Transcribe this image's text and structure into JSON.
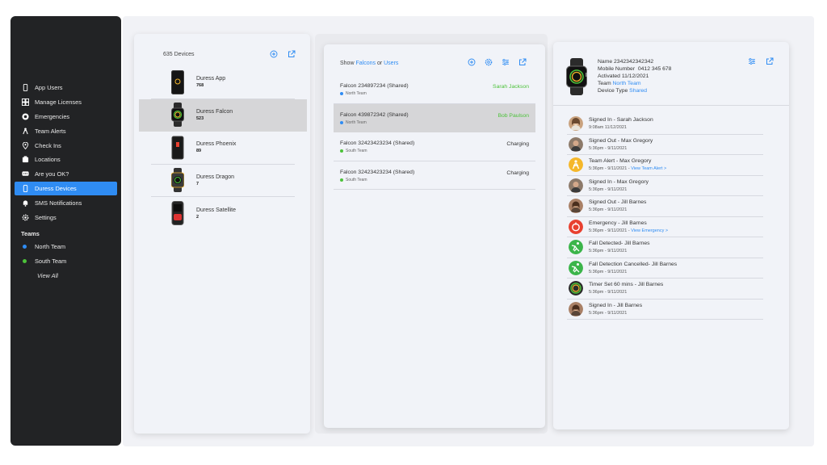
{
  "sidebar": {
    "items": [
      {
        "label": "App Users",
        "icon": "phone-icon",
        "active": false
      },
      {
        "label": "Manage Licenses",
        "icon": "licenses-icon",
        "active": false
      },
      {
        "label": "Emergencies",
        "icon": "emergency-icon",
        "active": false
      },
      {
        "label": "Team Alerts",
        "icon": "team-alert-icon",
        "active": false
      },
      {
        "label": "Check Ins",
        "icon": "location-pin-icon",
        "active": false
      },
      {
        "label": "Locations",
        "icon": "locations-icon",
        "active": false
      },
      {
        "label": "Are you OK?",
        "icon": "chat-icon",
        "active": false
      },
      {
        "label": "Duress Devices",
        "icon": "device-icon",
        "active": true
      },
      {
        "label": "SMS Notifications",
        "icon": "bell-icon",
        "active": false
      },
      {
        "label": "Settings",
        "icon": "gear-icon",
        "active": false
      }
    ],
    "teams_heading": "Teams",
    "teams": [
      {
        "label": "North Team",
        "color": "#2f8cf3"
      },
      {
        "label": "South Team",
        "color": "#4cc23a"
      }
    ],
    "view_all": "View All"
  },
  "devices_panel": {
    "count_label": "635 Devices",
    "devices": [
      {
        "name": "Duress App",
        "count": "768"
      },
      {
        "name": "Duress Falcon",
        "count": "523"
      },
      {
        "name": "Duress Phoenix",
        "count": "89"
      },
      {
        "name": "Duress Dragon",
        "count": "7"
      },
      {
        "name": "Duress Satellite",
        "count": "2"
      }
    ]
  },
  "falcons_panel": {
    "show_prefix": "Show",
    "show_falcons": "Falcons",
    "show_or": "or",
    "show_users": "Users",
    "rows": [
      {
        "name": "Falcon 234897234 (Shared)",
        "team": "North Team",
        "team_color": "#2f8cf3",
        "status": "Sarah Jackson",
        "status_color": "#4cc23a"
      },
      {
        "name": "Falcon 439872342 (Shared)",
        "team": "North Team",
        "team_color": "#2f8cf3",
        "status": "Bob Paulson",
        "status_color": "#4cc23a"
      },
      {
        "name": "Falcon 32423423234 (Shared)",
        "team": "South Team",
        "team_color": "#4cc23a",
        "status": "Charging",
        "status_color": "#333333"
      },
      {
        "name": "Falcon 32423423234 (Shared)",
        "team": "South Team",
        "team_color": "#4cc23a",
        "status": "Charging",
        "status_color": "#333333"
      }
    ]
  },
  "detail_panel": {
    "name_label": "Name",
    "name_value": "2342342342342",
    "mobile_label": "Mobile Number",
    "mobile_value": "0412 345 678",
    "activated_label": "Activated",
    "activated_value": "11/12/2021",
    "team_label": "Team",
    "team_value": "North Team",
    "device_type_label": "Device Type",
    "device_type_value": "Shared",
    "activity": [
      {
        "title": "Signed In - Sarah Jackson",
        "sub": "9:08am 11/12/2021",
        "link": "",
        "avatar": "avatar-sarah",
        "color": "#b98a66"
      },
      {
        "title": "Signed Out - Max Gregory",
        "sub": "5:36pm - 9/11/2021",
        "link": "",
        "avatar": "avatar-max",
        "color": "#7a5c4a"
      },
      {
        "title": "Team Alert - Max Gregory",
        "sub": "5:36pm - 9/11/2021 - ",
        "link": "View Team Alert >",
        "avatar": "team-alert-icon",
        "color": "#f5b72a"
      },
      {
        "title": "Signed In - Max Gregory",
        "sub": "5:36pm - 9/11/2021",
        "link": "",
        "avatar": "avatar-max",
        "color": "#7a5c4a"
      },
      {
        "title": "Signed Out - Jill Barnes",
        "sub": "5:36pm - 9/11/2021",
        "link": "",
        "avatar": "avatar-jill",
        "color": "#9a6a4e"
      },
      {
        "title": "Emergency - Jill Barnes",
        "sub": "5:36pm - 9/11/2021 - ",
        "link": "View Emergency >",
        "avatar": "emergency-icon",
        "color": "#e8402f"
      },
      {
        "title": "Fall Detected- Jill Barnes",
        "sub": "5:36pm - 9/11/2021",
        "link": "",
        "avatar": "fall-icon",
        "color": "#3bb54a"
      },
      {
        "title": "Fall Detection Cancelled- Jill Barnes",
        "sub": "5:36pm - 9/11/2021",
        "link": "",
        "avatar": "fall-icon",
        "color": "#3bb54a"
      },
      {
        "title": "Timer Set 60 mins - Jill Barnes",
        "sub": "5:36pm - 9/11/2021",
        "link": "",
        "avatar": "timer-icon",
        "color": "#2b2b2b"
      },
      {
        "title": "Signed In - Jill Barnes",
        "sub": "5:36pm - 9/11/2021",
        "link": "",
        "avatar": "avatar-jill",
        "color": "#9a6a4e"
      }
    ]
  },
  "colors": {
    "accent": "#2f8cf3",
    "green": "#4cc23a",
    "sidebar": "#222325"
  }
}
